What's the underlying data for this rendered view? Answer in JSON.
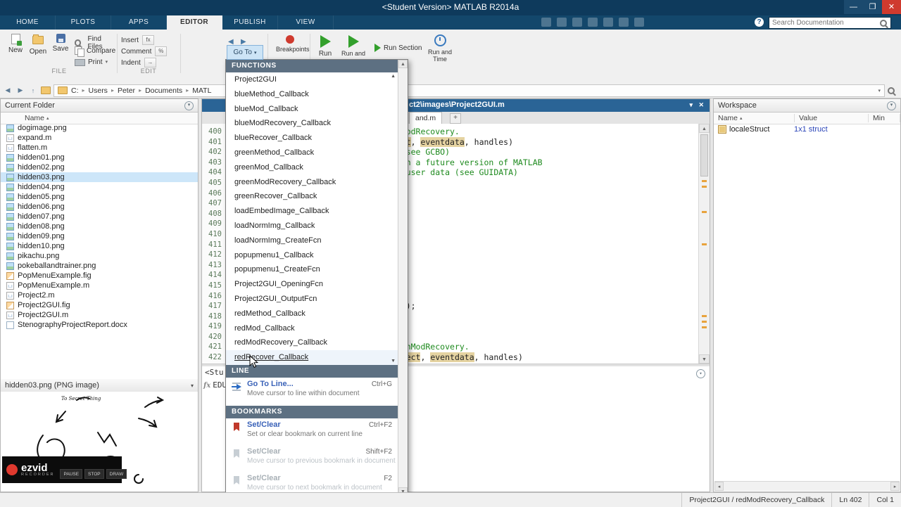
{
  "colors": {
    "titlebar": "#0e3a5c",
    "tabstrip": "#13476b",
    "active_tab_text": "#333333",
    "panel_title_bar": "#2a6496",
    "menu_header": "#5d7082",
    "comment": "#1e8a1e",
    "var_highlight": "#e5d3a1",
    "selection": "#cde6f9",
    "close_red": "#cf3a2e",
    "run_green": "#33a02c",
    "marker_orange": "#e8a33d",
    "recorder_red": "#e0392e"
  },
  "icons": {
    "minimize": "—",
    "restore": "❐",
    "close": "✕",
    "sort_asc": "▴",
    "chevron_down": "▾",
    "chevron_up": "▴",
    "back": "◀",
    "forward": "▶",
    "up": "↑",
    "crumb_sep": "▸",
    "scroll_up": "▲",
    "scroll_down": "▼",
    "left_small": "◂",
    "right_small": "▸",
    "plus": "+",
    "help_mark": "?",
    "fx": "fx",
    "edit_chip_insert": "fx",
    "edit_chip_comment": "%",
    "edit_chip_indent": "→"
  },
  "window": {
    "title": "<Student Version> MATLAB R2014a"
  },
  "tabstrip": {
    "tabs": [
      "HOME",
      "PLOTS",
      "APPS",
      "EDITOR",
      "PUBLISH",
      "VIEW"
    ],
    "active": "EDITOR",
    "search_placeholder": "Search Documentation"
  },
  "ribbon": {
    "file": {
      "section": "FILE",
      "new": "New",
      "open": "Open",
      "save": "Save",
      "find_files": "Find Files",
      "compare": "Compare",
      "print": "Print"
    },
    "edit": {
      "section": "EDIT",
      "insert": "Insert",
      "comment": "Comment",
      "indent": "Indent"
    },
    "navigate": {
      "goto": "Go To"
    },
    "breakpoints": {
      "label": "Breakpoints"
    },
    "run": {
      "run": "Run",
      "run_and": "Run and",
      "run_section": "Run Section",
      "run_and_time": "Run and Time"
    }
  },
  "breadcrumb": {
    "segments": [
      "C:",
      "Users",
      "Peter",
      "Documents",
      "MATL"
    ]
  },
  "current_folder": {
    "title": "Current Folder",
    "name_header": "Name",
    "selected": "hidden03.png",
    "files": [
      {
        "name": "dogimage.png",
        "type": "png"
      },
      {
        "name": "expand.m",
        "type": "m"
      },
      {
        "name": "flatten.m",
        "type": "m"
      },
      {
        "name": "hidden01.png",
        "type": "png"
      },
      {
        "name": "hidden02.png",
        "type": "png"
      },
      {
        "name": "hidden03.png",
        "type": "png"
      },
      {
        "name": "hidden04.png",
        "type": "png"
      },
      {
        "name": "hidden05.png",
        "type": "png"
      },
      {
        "name": "hidden06.png",
        "type": "png"
      },
      {
        "name": "hidden07.png",
        "type": "png"
      },
      {
        "name": "hidden08.png",
        "type": "png"
      },
      {
        "name": "hidden09.png",
        "type": "png"
      },
      {
        "name": "hidden10.png",
        "type": "png"
      },
      {
        "name": "pikachu.png",
        "type": "png"
      },
      {
        "name": "pokeballandtrainer.png",
        "type": "png"
      },
      {
        "name": "PopMenuExample.fig",
        "type": "fig"
      },
      {
        "name": "PopMenuExample.m",
        "type": "m"
      },
      {
        "name": "Project2.m",
        "type": "m"
      },
      {
        "name": "Project2GUI.fig",
        "type": "fig"
      },
      {
        "name": "Project2GUI.m",
        "type": "m"
      },
      {
        "name": "StenographyProjectReport.docx",
        "type": "docx"
      }
    ],
    "preview": {
      "title": "hidden03.png (PNG image)",
      "annotation": "To Secret Thing"
    }
  },
  "recorder": {
    "brand": "ezvid",
    "subtitle": "RECORDER",
    "buttons": [
      "PAUSE",
      "STOP",
      "DRAW"
    ]
  },
  "editor": {
    "title_fragment": "ct2\\images\\Project2GUI.m",
    "tab_fragment": "and.m",
    "new_tab": "+",
    "lines": [
      {
        "n": "400",
        "seg": [
          {
            "t": "redModRecovery.",
            "c": "comment"
          }
        ]
      },
      {
        "n": "401",
        "seg": [
          {
            "t": "bject",
            "c": "hl"
          },
          {
            "t": ", ",
            "c": "code"
          },
          {
            "t": "eventdata",
            "c": "hl"
          },
          {
            "t": ", handles)",
            "c": "code"
          }
        ]
      },
      {
        "n": "402",
        "seg": [
          {
            "t": "ry (see GCBO)",
            "c": "comment"
          }
        ]
      },
      {
        "n": "403",
        "seg": [
          {
            "t": "ed in a future version of MATLAB",
            "c": "comment"
          }
        ]
      },
      {
        "n": "404",
        "seg": [
          {
            "t": "and user data (see GUIDATA)",
            "c": "comment"
          }
        ]
      },
      {
        "n": "405",
        "seg": []
      },
      {
        "n": "406",
        "seg": []
      },
      {
        "n": "407",
        "seg": []
      },
      {
        "n": "408",
        "seg": []
      },
      {
        "n": "409",
        "seg": []
      },
      {
        "n": "410",
        "seg": [
          {
            "t": "0)",
            "c": "code"
          }
        ]
      },
      {
        "n": "411",
        "seg": []
      },
      {
        "n": "412",
        "seg": []
      },
      {
        "n": "413",
        "seg": []
      },
      {
        "n": "414",
        "seg": []
      },
      {
        "n": "415",
        "seg": []
      },
      {
        "n": "416",
        "seg": []
      },
      {
        "n": "417",
        "seg": [
          {
            "t": "yImg);",
            "c": "code"
          }
        ]
      },
      {
        "n": "418",
        "seg": []
      },
      {
        "n": "419",
        "seg": []
      },
      {
        "n": "420",
        "seg": []
      },
      {
        "n": "421",
        "seg": [
          {
            "t": "greenModRecovery.",
            "c": "comment"
          }
        ]
      },
      {
        "n": "422",
        "seg": [
          {
            "t": "hObject",
            "c": "hl"
          },
          {
            "t": ", ",
            "c": "code"
          },
          {
            "t": "eventdata",
            "c": "hl"
          },
          {
            "t": ", handles)",
            "c": "code"
          }
        ]
      }
    ]
  },
  "goto_menu": {
    "functions_header": "FUNCTIONS",
    "line_header": "LINE",
    "bookmarks_header": "BOOKMARKS",
    "functions": [
      "Project2GUI",
      "blueMethod_Callback",
      "blueMod_Callback",
      "blueModRecovery_Callback",
      "blueRecover_Callback",
      "greenMethod_Callback",
      "greenMod_Callback",
      "greenModRecovery_Callback",
      "greenRecover_Callback",
      "loadEmbedImage_Callback",
      "loadNormImg_Callback",
      "loadNormImg_CreateFcn",
      "popupmenu1_Callback",
      "popupmenu1_CreateFcn",
      "Project2GUI_OpeningFcn",
      "Project2GUI_OutputFcn",
      "redMethod_Callback",
      "redMod_Callback",
      "redModRecovery_Callback",
      "redRecover_Callback"
    ],
    "hovered": "redRecover_Callback",
    "line_item": {
      "title": "Go To Line...",
      "shortcut": "Ctrl+G",
      "desc": "Move cursor to line within document"
    },
    "bookmarks": [
      {
        "title": "Set/Clear",
        "shortcut": "Ctrl+F2",
        "desc": "Set or clear bookmark on current line",
        "enabled": true
      },
      {
        "title": "Set/Clear",
        "shortcut": "Shift+F2",
        "desc": "Move cursor to previous bookmark in document",
        "enabled": false
      },
      {
        "title": "Set/Clear",
        "shortcut": "F2",
        "desc": "Move cursor to next bookmark in document",
        "enabled": false
      }
    ]
  },
  "command_window": {
    "banner_fragment": "<Stu",
    "fx": "fx",
    "prompt_fragment": "EDU"
  },
  "workspace": {
    "title": "Workspace",
    "columns": [
      "Name",
      "Value",
      "Min"
    ],
    "rows": [
      {
        "name": "localeStruct",
        "value": "1x1 struct"
      }
    ]
  },
  "status_bar": {
    "context": "Project2GUI / redModRecovery_Callback",
    "line": "Ln 402",
    "col": "Col 1"
  }
}
